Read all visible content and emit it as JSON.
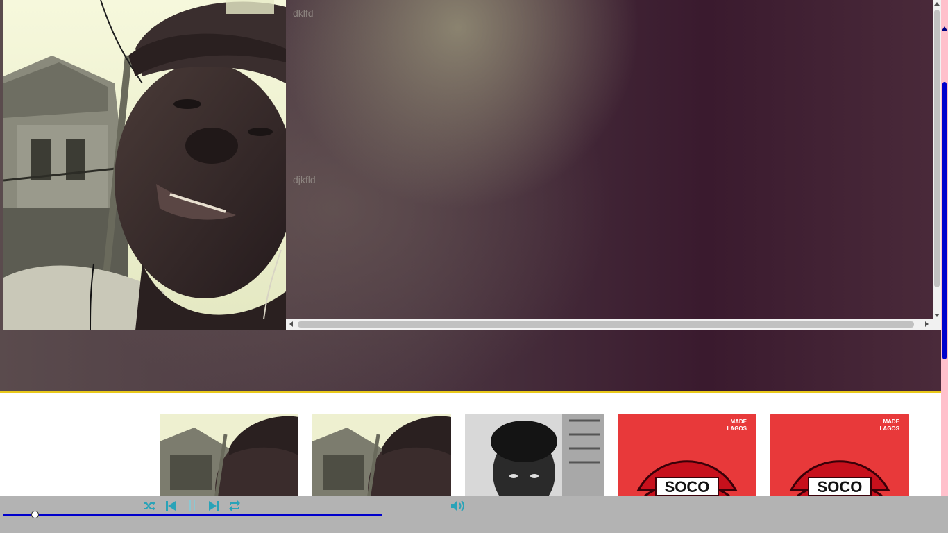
{
  "hero": {
    "photo_alt": "profile photo",
    "info_lines": [
      "dklfd",
      "djkfld"
    ]
  },
  "gallery": {
    "cards": [
      {
        "image": "selfie-cap-photo"
      },
      {
        "image": "selfie-cap-photo"
      },
      {
        "image": "bw-portrait-photo"
      },
      {
        "image": "soco-lips-artwork",
        "text": "SOCO"
      },
      {
        "image": "soco-lips-artwork",
        "text": "SOCO"
      }
    ],
    "artwork_badge": "MADE LAGOS"
  },
  "player": {
    "controls": [
      "shuffle-icon",
      "previous-icon",
      "pause-icon",
      "next-icon",
      "repeat-icon",
      "volume-icon"
    ],
    "progress": 0.085
  },
  "colors": {
    "accent_cyan": "#2aa3b8",
    "progress_blue": "#0000cc",
    "hero_border": "#e8c81a",
    "scrollbar_track": "#ffc0cb",
    "player_bg": "#b3b3b3",
    "artwork_red": "#e8393a"
  }
}
